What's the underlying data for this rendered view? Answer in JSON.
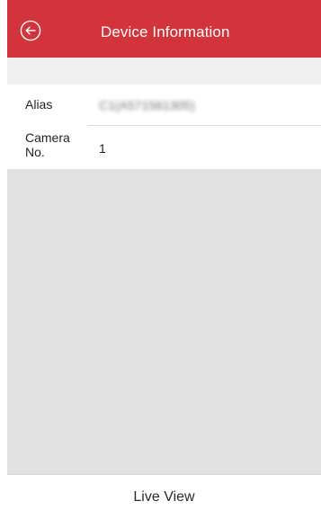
{
  "header": {
    "title": "Device Information",
    "back_icon": "back-arrow-circle-icon",
    "background_color": "#d3333b"
  },
  "device_info": {
    "rows": [
      {
        "label": "Alias",
        "value": "C1(A571561305)"
      },
      {
        "label": "Camera No.",
        "value": "1"
      }
    ]
  },
  "footer": {
    "live_view_label": "Live View"
  }
}
